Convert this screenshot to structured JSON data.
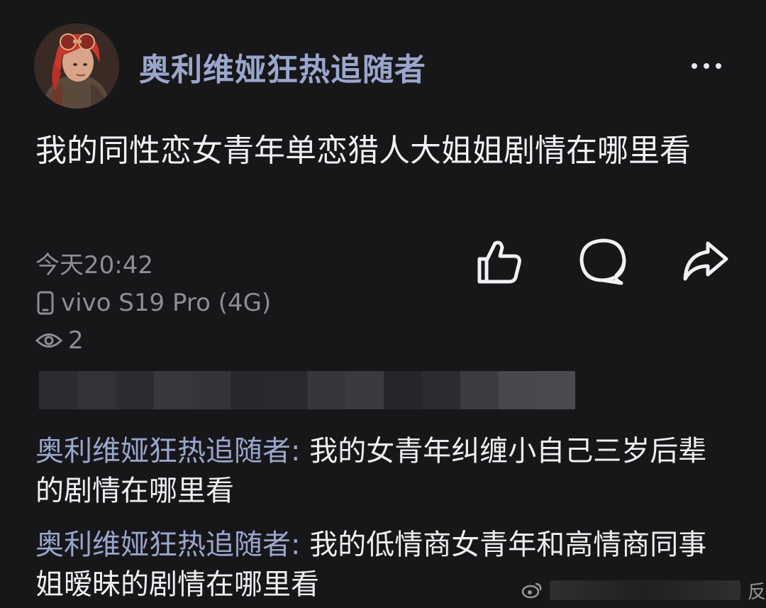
{
  "post": {
    "author": "奥利维娅狂热追随者",
    "text": "我的同性恋女青年单恋猎人大姐姐剧情在哪里看",
    "time": "今天20:42",
    "device": "vivo S19 Pro (4G)",
    "views": "2"
  },
  "icons": {
    "more": "more-dots-icon",
    "like": "thumbs-up-icon",
    "comment": "speech-bubble-icon",
    "share": "share-arrow-icon",
    "device": "phone-icon",
    "views": "eye-icon"
  },
  "comments": [
    {
      "author": "奥利维娅狂热追随者",
      "separator": ": ",
      "text": "我的女青年纠缠小自己三岁后辈的剧情在哪里看"
    },
    {
      "author": "奥利维娅狂热追随者",
      "separator": ": ",
      "text": "我的低情商女青年和高情商同事姐暧昧的剧情在哪里看"
    }
  ],
  "watermark": {
    "suffix": "反"
  },
  "colors": {
    "background": "#17171a",
    "author_name": "#9aa6cc",
    "meta_text": "#8d8d93",
    "body_text": "#f2f2f5"
  }
}
